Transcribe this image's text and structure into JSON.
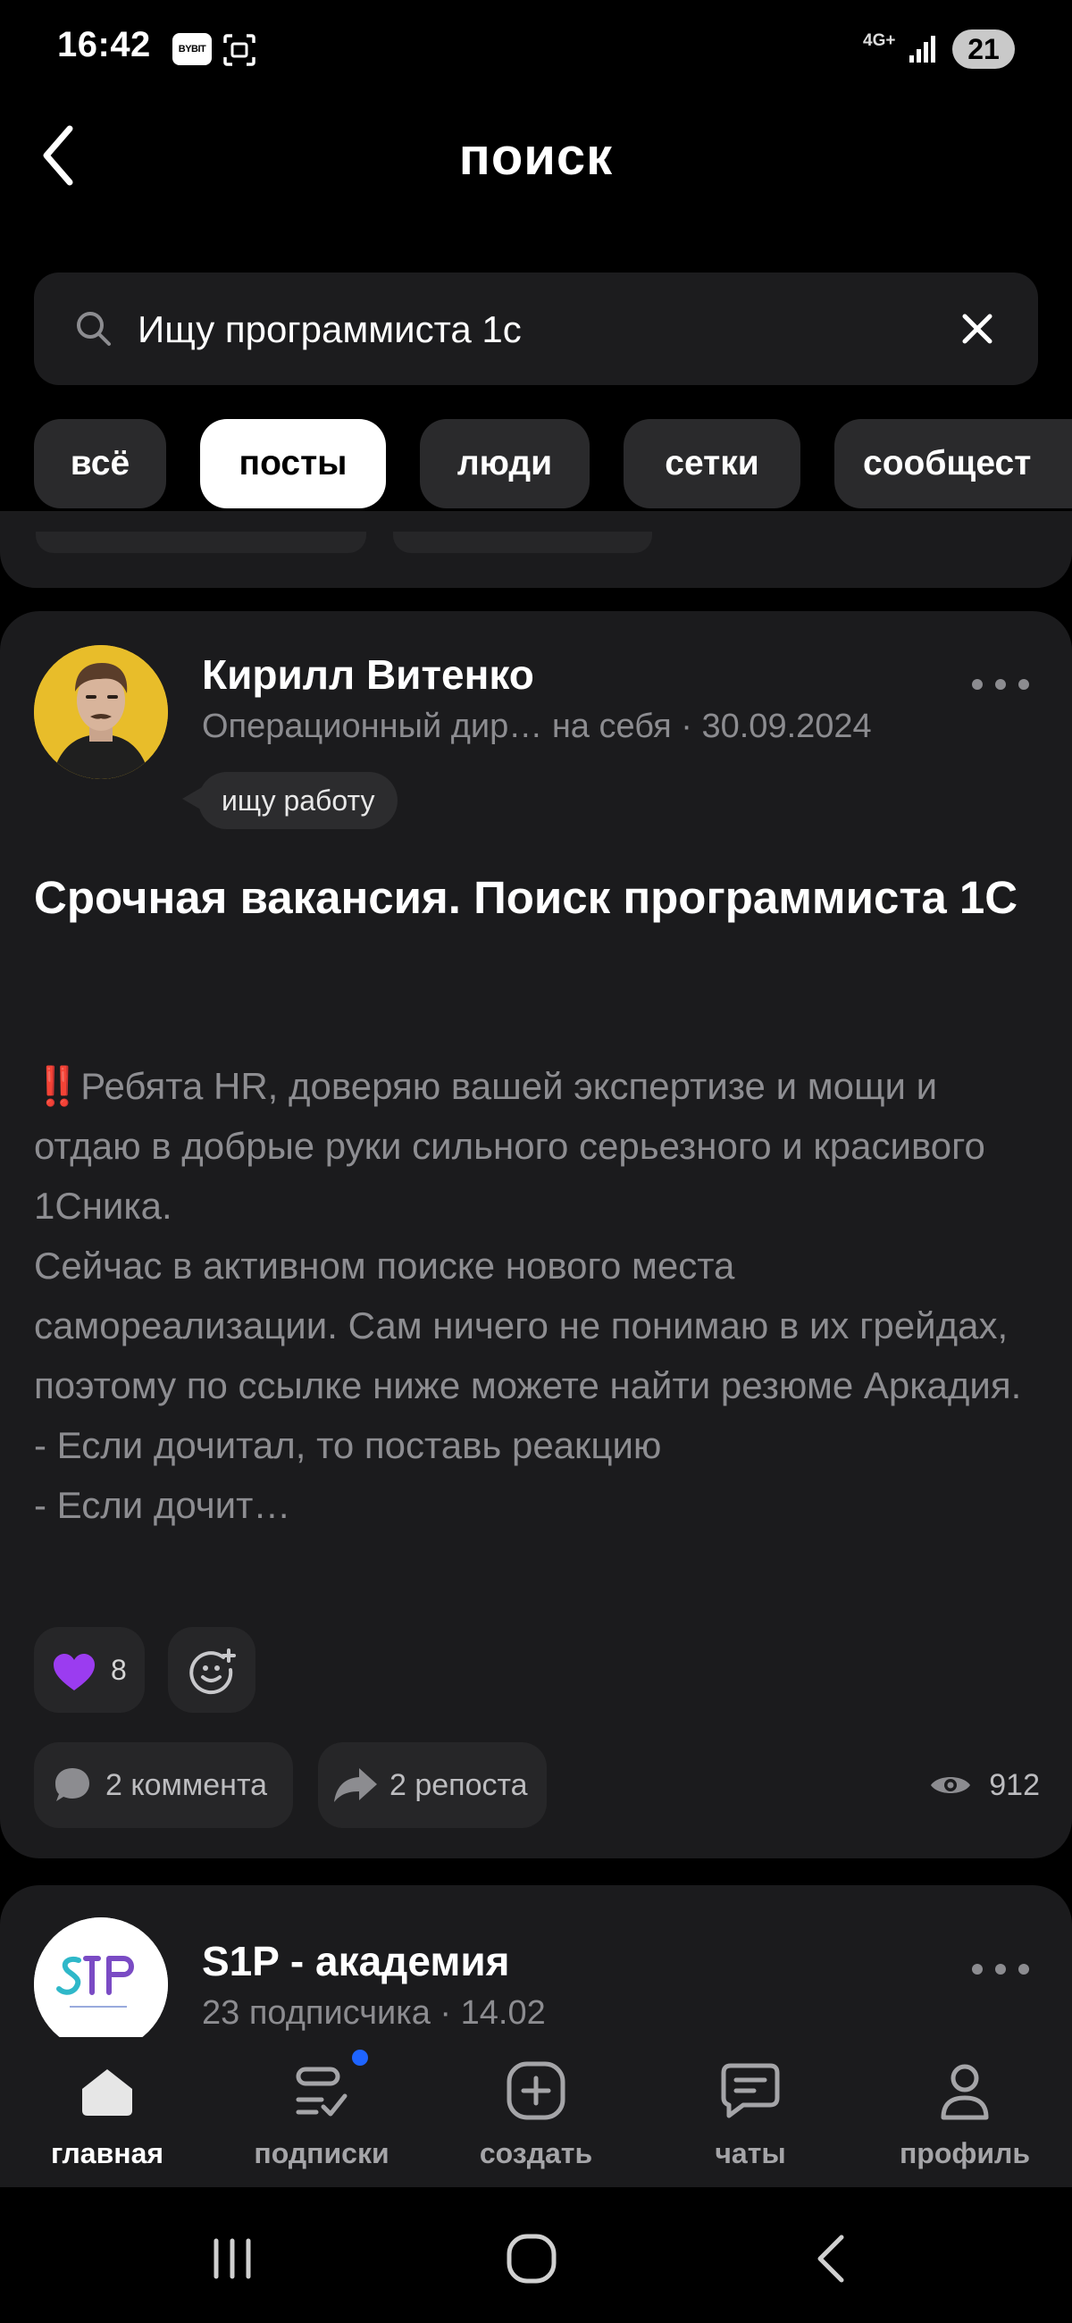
{
  "status_bar": {
    "time": "16:42",
    "app_badge": "BYBIT",
    "network": "4G+",
    "battery": "21"
  },
  "header": {
    "title": "поиск"
  },
  "search": {
    "query": "Ищу программиста 1с",
    "icon": "search-icon",
    "clear_icon": "close-icon"
  },
  "tabs": [
    {
      "label": "всё",
      "active": false
    },
    {
      "label": "посты",
      "active": true
    },
    {
      "label": "люди",
      "active": false
    },
    {
      "label": "сетки",
      "active": false
    },
    {
      "label": "сообщест",
      "active": false
    }
  ],
  "post": {
    "author": "Кирилл Витенко",
    "meta": "Операционный дир… на себя · 30.09.2024",
    "tag": "ищу работу",
    "title": "Срочная вакансия. Поиск программиста 1С",
    "body_emoji": "‼️",
    "body": "Ребята HR, доверяю вашей экспертизе и мощи и отдаю в добрые руки сильного серьезного и красивого 1Сника.\nСейчас в активном поиске нового места самореализации. Сам ничего не понимаю в их грейдах, поэтому по ссылке ниже можете найти резюме Аркадия.\n- Если дочитал, то поставь реакцию\n- Если дочит…",
    "reaction_count": "8",
    "comments": "2 коммента",
    "reposts": "2 репоста",
    "views": "912",
    "accent_heart": "#9b3cf0"
  },
  "next_post": {
    "author": "S1P - академия",
    "meta": "23 подписчика · 14.02"
  },
  "bottom_nav": [
    {
      "label": "главная",
      "icon": "home-icon",
      "active": true
    },
    {
      "label": "подписки",
      "icon": "subscriptions-icon",
      "active": false
    },
    {
      "label": "создать",
      "icon": "plus-square-icon",
      "active": false
    },
    {
      "label": "чаты",
      "icon": "chat-icon",
      "active": false
    },
    {
      "label": "профиль",
      "icon": "profile-icon",
      "active": false
    }
  ]
}
